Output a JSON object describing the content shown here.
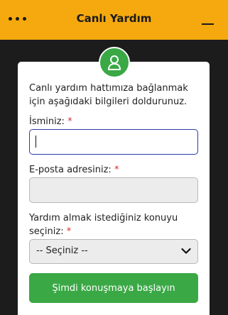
{
  "header": {
    "title": "Canlı Yardım"
  },
  "form": {
    "intro": "Canlı yardım hattımıza bağlanmak için aşağıdaki bilgileri doldurunuz.",
    "name_label": "İsminiz:",
    "name_value": "",
    "email_label": "E-posta adresiniz:",
    "email_value": "",
    "topic_label": "Yardım almak istediğiniz konuyu seçiniz:",
    "topic_selected": "-- Seçiniz --",
    "required_mark": "*",
    "submit_label": "Şimdi konuşmaya başlayın"
  },
  "colors": {
    "header_bg": "#f5a90f",
    "accent_green": "#3aa845",
    "focus_border": "#2a3ba8",
    "required": "#d32f2f",
    "panel_bg": "#1c1c1c"
  },
  "icons": {
    "menu": "three-dots-icon",
    "minimize": "minimize-icon",
    "avatar": "user-icon",
    "select": "chevron-down-icon"
  }
}
